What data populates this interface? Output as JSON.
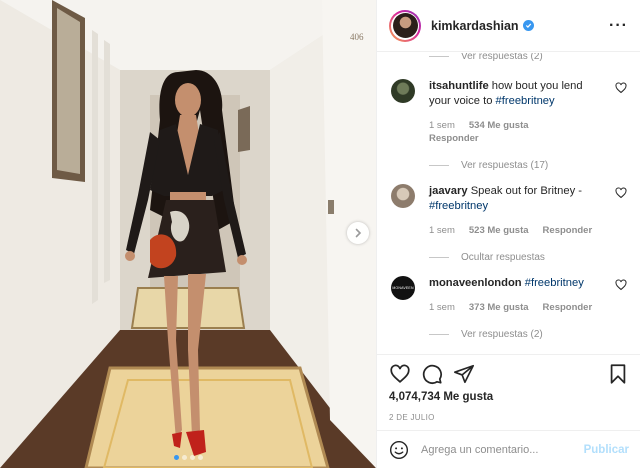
{
  "post": {
    "username": "kimkardashian",
    "verified": true,
    "more_label": "···",
    "likes": "4,074,734 Me gusta",
    "date": "2 DE JULIO",
    "door_number": "406",
    "carousel_dots": 4,
    "carousel_active": 0
  },
  "comments": [
    {
      "type": "replies",
      "label": "Ver respuestas (2)"
    },
    {
      "type": "comment",
      "user": "itsahuntlife",
      "text": "how bout you lend your voice to ",
      "tag": "#freebritney",
      "time": "1 sem",
      "likes": "534 Me gusta",
      "reply": "Responder",
      "replies_label": "Ver respuestas (17)"
    },
    {
      "type": "comment",
      "user": "jaavary",
      "text": "Speak out for Britney - ",
      "tag": "#freebritney",
      "time": "1 sem",
      "likes": "523 Me gusta",
      "reply": "Responder",
      "replies_label": "Ocultar respuestas"
    },
    {
      "type": "comment",
      "user": "monaveenlondon",
      "text": "",
      "tag": "#freebritney",
      "time": "1 sem",
      "likes": "373 Me gusta",
      "reply": "Responder",
      "replies_label": "Ver respuestas (2)"
    }
  ],
  "avatar_labels": {
    "monaveen": "MONAVEEN"
  },
  "composer": {
    "placeholder": "Agrega un comentario...",
    "publish": "Publicar"
  },
  "colors": {
    "link": "#00376b",
    "verified": "#3897f0",
    "publish_disabled": "#b2dffc"
  }
}
